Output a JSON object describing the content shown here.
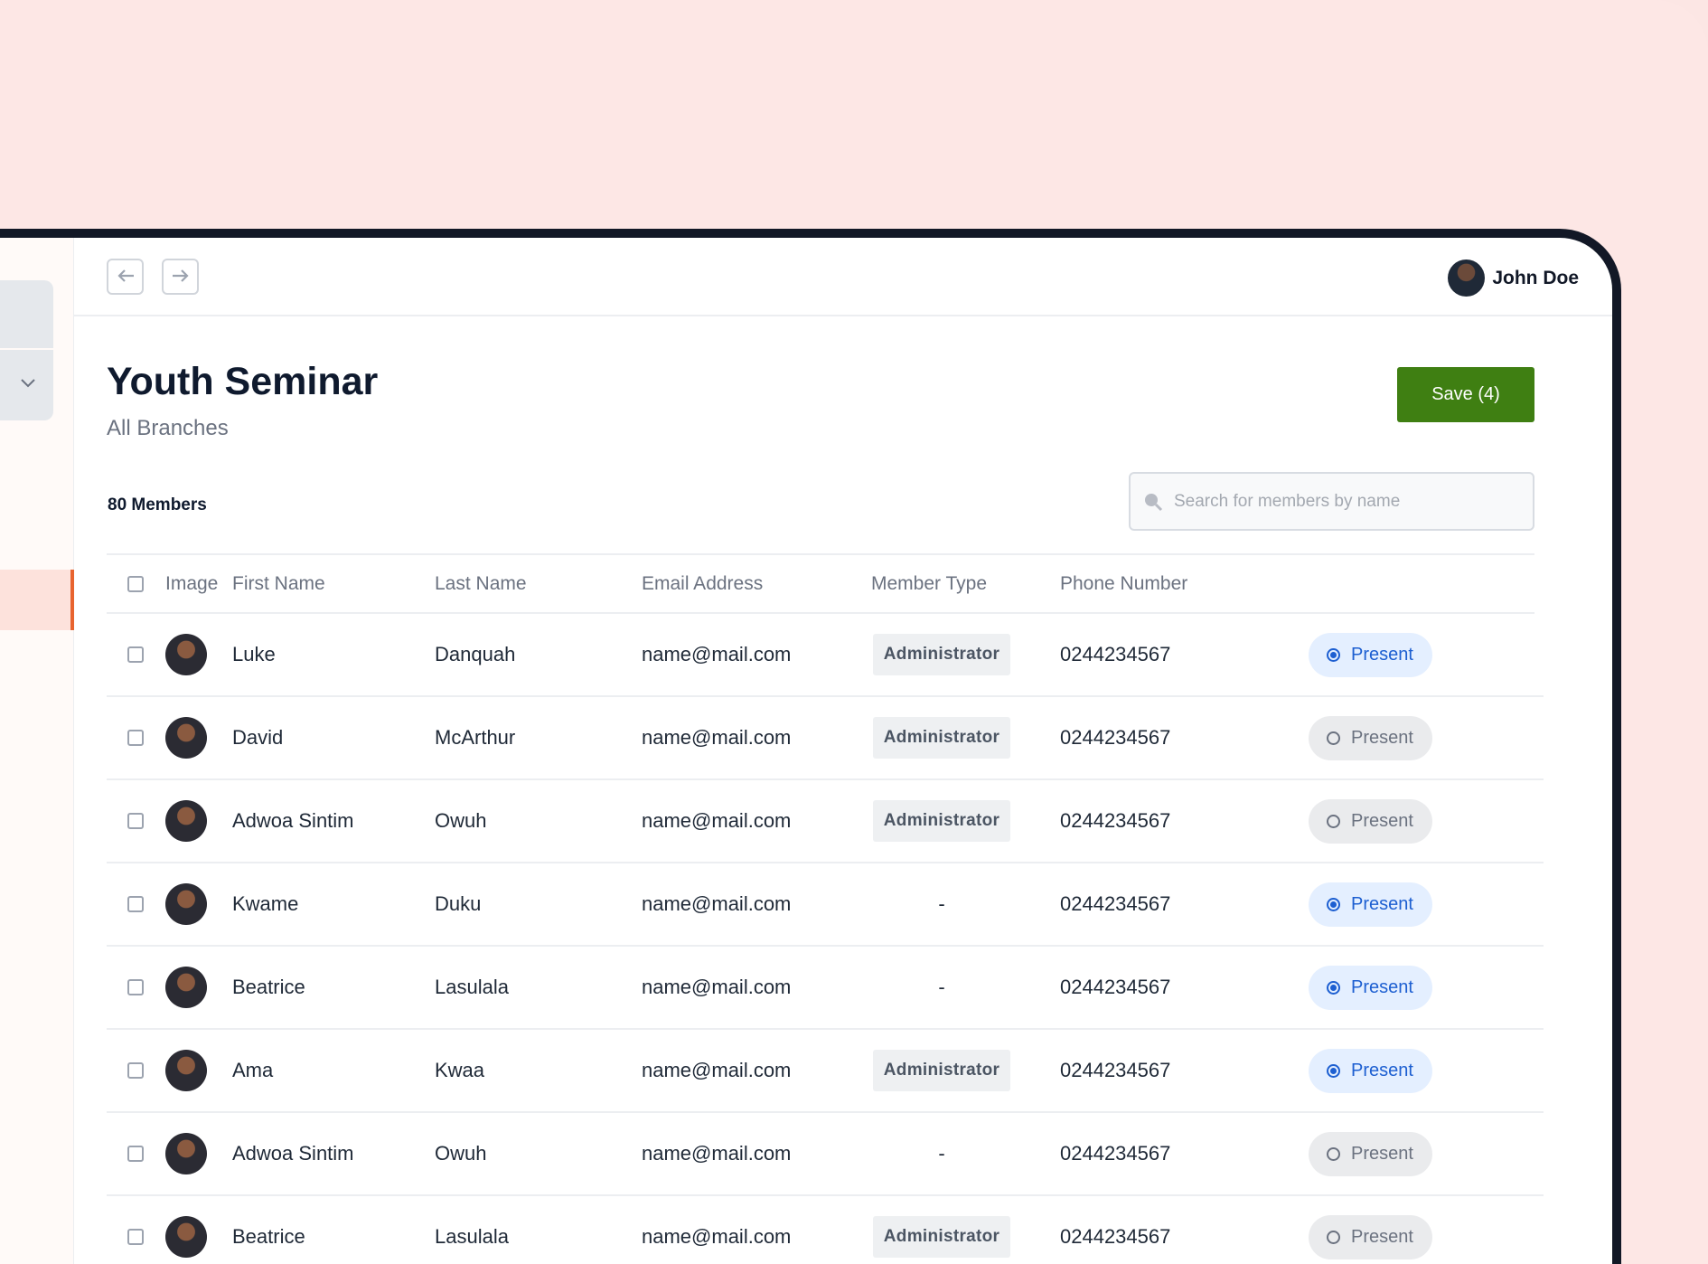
{
  "user": {
    "name": "John Doe"
  },
  "header": {
    "title": "Youth Seminar",
    "subtitle": "All Branches",
    "save_label": "Save (4)",
    "member_count": "80 Members"
  },
  "search": {
    "placeholder": "Search for members by name",
    "value": ""
  },
  "table": {
    "columns": [
      "Image",
      "First Name",
      "Last Name",
      "Email Address",
      "Member Type",
      "Phone Number"
    ],
    "rows": [
      {
        "first": "Luke",
        "last": "Danquah",
        "email": "name@mail.com",
        "type": "Administrator",
        "phone": "0244234567",
        "status": "Present",
        "present": true
      },
      {
        "first": "David",
        "last": "McArthur",
        "email": "name@mail.com",
        "type": "Administrator",
        "phone": "0244234567",
        "status": "Present",
        "present": false
      },
      {
        "first": "Adwoa Sintim",
        "last": "Owuh",
        "email": "name@mail.com",
        "type": "Administrator",
        "phone": "0244234567",
        "status": "Present",
        "present": false
      },
      {
        "first": "Kwame",
        "last": "Duku",
        "email": "name@mail.com",
        "type": "-",
        "phone": "0244234567",
        "status": "Present",
        "present": true
      },
      {
        "first": "Beatrice",
        "last": "Lasulala",
        "email": "name@mail.com",
        "type": "-",
        "phone": "0244234567",
        "status": "Present",
        "present": true
      },
      {
        "first": "Ama",
        "last": "Kwaa",
        "email": "name@mail.com",
        "type": "Administrator",
        "phone": "0244234567",
        "status": "Present",
        "present": true
      },
      {
        "first": "Adwoa Sintim",
        "last": "Owuh",
        "email": "name@mail.com",
        "type": "-",
        "phone": "0244234567",
        "status": "Present",
        "present": false
      },
      {
        "first": "Beatrice",
        "last": "Lasulala",
        "email": "name@mail.com",
        "type": "Administrator",
        "phone": "0244234567",
        "status": "Present",
        "present": false
      }
    ]
  },
  "colors": {
    "background": "#fde7e5",
    "save_button": "#3f7f12",
    "present_on": "#1d5fd1",
    "sidebar_accent": "#e8632e"
  },
  "icons": {
    "back": "arrow-left-icon",
    "forward": "arrow-right-icon",
    "search": "search-icon",
    "chevron": "chevron-down-icon"
  }
}
